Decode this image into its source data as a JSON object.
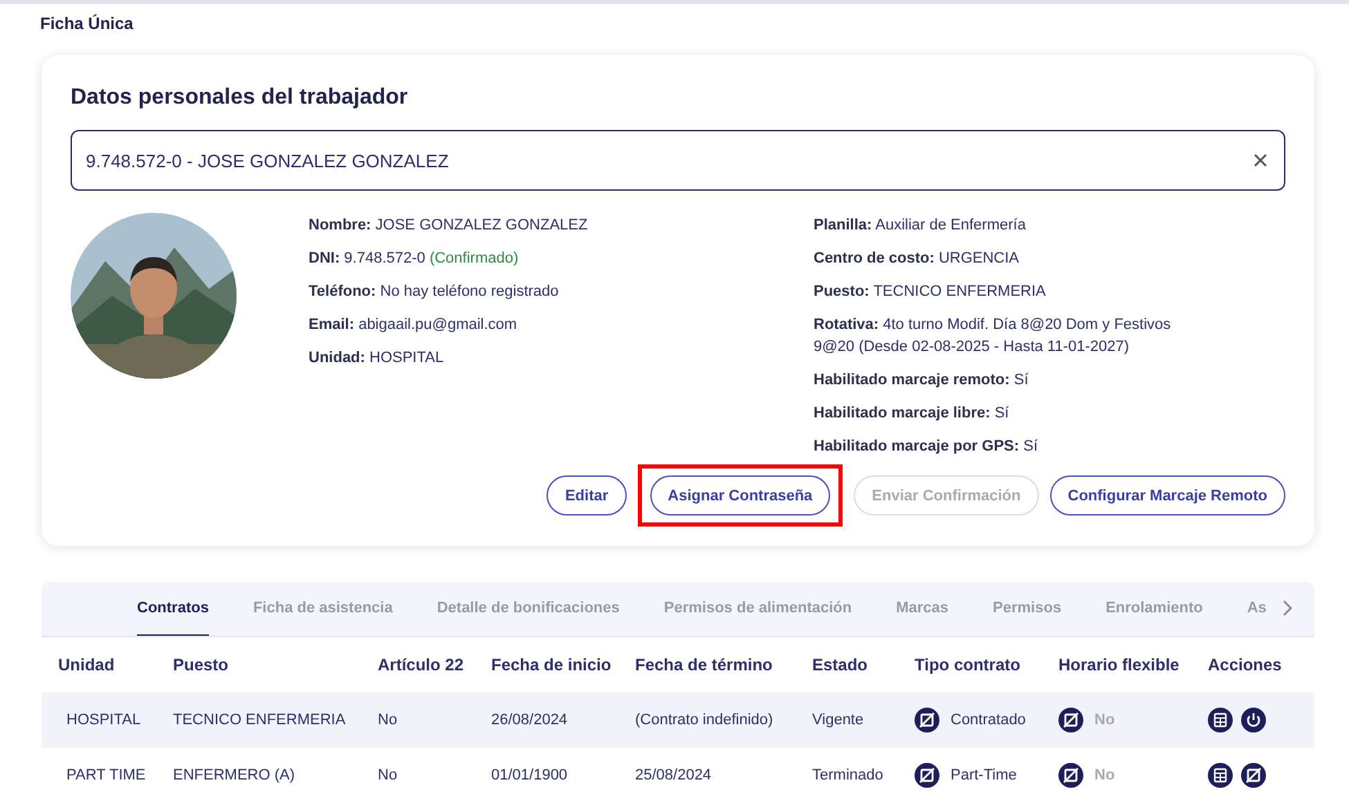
{
  "page_title": "Ficha Única",
  "card": {
    "title": "Datos personales del trabajador",
    "search": {
      "value": "9.748.572-0 - JOSE GONZALEZ GONZALEZ"
    },
    "fields_left": [
      {
        "label": "Nombre:",
        "value": "JOSE GONZALEZ GONZALEZ"
      },
      {
        "label": "DNI:",
        "value": "9.748.572-0",
        "note": "(Confirmado)"
      },
      {
        "label": "Teléfono:",
        "value": "No hay teléfono registrado"
      },
      {
        "label": "Email:",
        "value": "abigaail.pu@gmail.com"
      },
      {
        "label": "Unidad:",
        "value": "HOSPITAL"
      }
    ],
    "fields_right": [
      {
        "label": "Planilla:",
        "value": "Auxiliar de Enfermería"
      },
      {
        "label": "Centro de costo:",
        "value": "URGENCIA"
      },
      {
        "label": "Puesto:",
        "value": "TECNICO ENFERMERIA"
      },
      {
        "label": "Rotativa:",
        "value": "4to turno Modif. Día 8@20 Dom y Festivos 9@20 (Desde 02-08-2025 - Hasta 11-01-2027)"
      },
      {
        "label": "Habilitado marcaje remoto:",
        "value": "Sí"
      },
      {
        "label": "Habilitado marcaje libre:",
        "value": "Sí"
      },
      {
        "label": "Habilitado marcaje por GPS:",
        "value": "Sí"
      }
    ],
    "buttons": [
      {
        "label": "Editar",
        "disabled": false,
        "highlighted": false
      },
      {
        "label": "Asignar Contraseña",
        "disabled": false,
        "highlighted": true
      },
      {
        "label": "Enviar Confirmación",
        "disabled": true,
        "highlighted": false
      },
      {
        "label": "Configurar Marcaje Remoto",
        "disabled": false,
        "highlighted": false
      }
    ]
  },
  "tabs": [
    {
      "label": "Contratos",
      "selected": true
    },
    {
      "label": "Ficha de asistencia",
      "selected": false
    },
    {
      "label": "Detalle de bonificaciones",
      "selected": false
    },
    {
      "label": "Permisos de alimentación",
      "selected": false
    },
    {
      "label": "Marcas",
      "selected": false
    },
    {
      "label": "Permisos",
      "selected": false
    },
    {
      "label": "Enrolamiento",
      "selected": false
    },
    {
      "label": "As",
      "selected": false
    }
  ],
  "table": {
    "columns": [
      "Unidad",
      "Puesto",
      "Artículo 22",
      "Fecha de inicio",
      "Fecha de término",
      "Estado",
      "Tipo contrato",
      "Horario flexible",
      "Acciones"
    ],
    "rows": [
      {
        "cells": [
          "HOSPITAL",
          "TECNICO ENFERMERIA",
          "No",
          "26/08/2024",
          "(Contrato indefinido)",
          "Vigente"
        ],
        "tipo": "Contratado",
        "horario": {
          "label": "No",
          "on": false
        },
        "actions": [
          {
            "kind": "grid"
          },
          {
            "kind": "power"
          }
        ]
      },
      {
        "cells": [
          "PART TIME",
          "ENFERMERO (A)",
          "No",
          "01/01/1900",
          "25/08/2024",
          "Terminado"
        ],
        "tipo": "Part-Time",
        "horario": {
          "label": "No",
          "on": false
        },
        "actions": [
          {
            "kind": "grid"
          },
          {
            "kind": "edit"
          }
        ]
      }
    ]
  }
}
